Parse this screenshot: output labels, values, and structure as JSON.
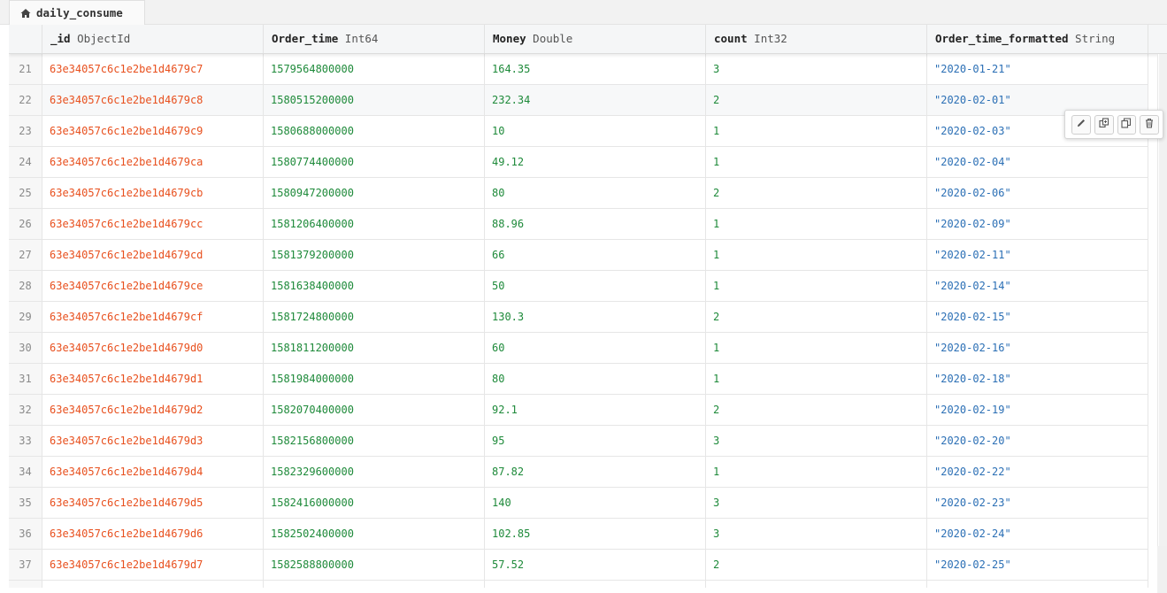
{
  "tab": {
    "title": "daily_consume",
    "icon": "home-icon"
  },
  "columns": [
    {
      "name": "_id",
      "type": "ObjectId"
    },
    {
      "name": "Order_time",
      "type": "Int64"
    },
    {
      "name": "Money",
      "type": "Double"
    },
    {
      "name": "count",
      "type": "Int32"
    },
    {
      "name": "Order_time_formatted",
      "type": "String"
    }
  ],
  "rows": [
    {
      "n": "21",
      "id": "63e34057c6c1e2be1d4679c7",
      "order_time": "1579564800000",
      "money": "164.35",
      "count": "3",
      "formatted": "\"2020-01-21\""
    },
    {
      "n": "22",
      "id": "63e34057c6c1e2be1d4679c8",
      "order_time": "1580515200000",
      "money": "232.34",
      "count": "2",
      "formatted": "\"2020-02-01\""
    },
    {
      "n": "23",
      "id": "63e34057c6c1e2be1d4679c9",
      "order_time": "1580688000000",
      "money": "10",
      "count": "1",
      "formatted": "\"2020-02-03\""
    },
    {
      "n": "24",
      "id": "63e34057c6c1e2be1d4679ca",
      "order_time": "1580774400000",
      "money": "49.12",
      "count": "1",
      "formatted": "\"2020-02-04\""
    },
    {
      "n": "25",
      "id": "63e34057c6c1e2be1d4679cb",
      "order_time": "1580947200000",
      "money": "80",
      "count": "2",
      "formatted": "\"2020-02-06\""
    },
    {
      "n": "26",
      "id": "63e34057c6c1e2be1d4679cc",
      "order_time": "1581206400000",
      "money": "88.96",
      "count": "1",
      "formatted": "\"2020-02-09\""
    },
    {
      "n": "27",
      "id": "63e34057c6c1e2be1d4679cd",
      "order_time": "1581379200000",
      "money": "66",
      "count": "1",
      "formatted": "\"2020-02-11\""
    },
    {
      "n": "28",
      "id": "63e34057c6c1e2be1d4679ce",
      "order_time": "1581638400000",
      "money": "50",
      "count": "1",
      "formatted": "\"2020-02-14\""
    },
    {
      "n": "29",
      "id": "63e34057c6c1e2be1d4679cf",
      "order_time": "1581724800000",
      "money": "130.3",
      "count": "2",
      "formatted": "\"2020-02-15\""
    },
    {
      "n": "30",
      "id": "63e34057c6c1e2be1d4679d0",
      "order_time": "1581811200000",
      "money": "60",
      "count": "1",
      "formatted": "\"2020-02-16\""
    },
    {
      "n": "31",
      "id": "63e34057c6c1e2be1d4679d1",
      "order_time": "1581984000000",
      "money": "80",
      "count": "1",
      "formatted": "\"2020-02-18\""
    },
    {
      "n": "32",
      "id": "63e34057c6c1e2be1d4679d2",
      "order_time": "1582070400000",
      "money": "92.1",
      "count": "2",
      "formatted": "\"2020-02-19\""
    },
    {
      "n": "33",
      "id": "63e34057c6c1e2be1d4679d3",
      "order_time": "1582156800000",
      "money": "95",
      "count": "3",
      "formatted": "\"2020-02-20\""
    },
    {
      "n": "34",
      "id": "63e34057c6c1e2be1d4679d4",
      "order_time": "1582329600000",
      "money": "87.82",
      "count": "1",
      "formatted": "\"2020-02-22\""
    },
    {
      "n": "35",
      "id": "63e34057c6c1e2be1d4679d5",
      "order_time": "1582416000000",
      "money": "140",
      "count": "3",
      "formatted": "\"2020-02-23\""
    },
    {
      "n": "36",
      "id": "63e34057c6c1e2be1d4679d6",
      "order_time": "1582502400000",
      "money": "102.85",
      "count": "3",
      "formatted": "\"2020-02-24\""
    },
    {
      "n": "37",
      "id": "63e34057c6c1e2be1d4679d7",
      "order_time": "1582588800000",
      "money": "57.52",
      "count": "2",
      "formatted": "\"2020-02-25\""
    }
  ],
  "row_actions": {
    "hovered_row": "22",
    "buttons": [
      {
        "icon": "pencil-icon"
      },
      {
        "icon": "clone-icon"
      },
      {
        "icon": "copy-icon"
      },
      {
        "icon": "trash-icon"
      }
    ]
  },
  "colors": {
    "id": "#e8501e",
    "number": "#1e8a3a",
    "string": "#2b6fb5",
    "row_number": "#8a8a8a"
  }
}
